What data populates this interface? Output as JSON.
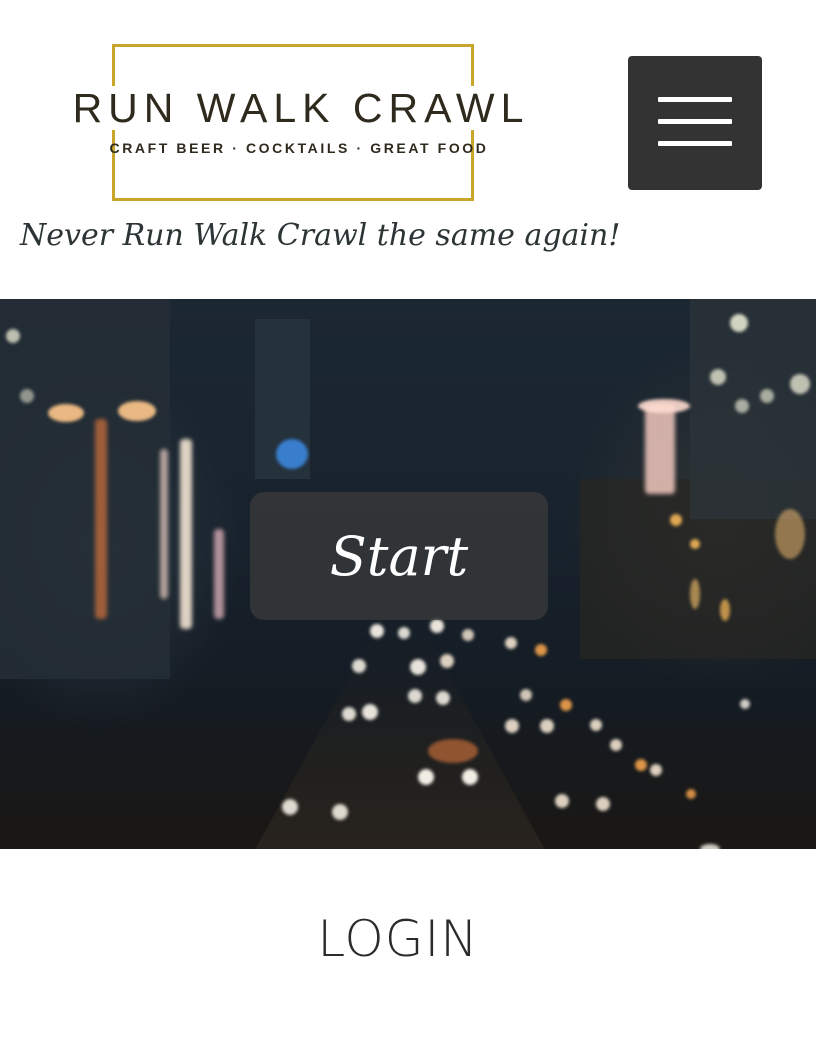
{
  "header": {
    "logo": {
      "title": "RUN WALK CRAWL",
      "tagline": "CRAFT BEER · COCKTAILS · GREAT FOOD",
      "border_color": "#c9a52c"
    },
    "menu_icon": "hamburger-menu-icon",
    "tagline": "Never Run Walk Crawl the same again!"
  },
  "hero": {
    "background": "blurred city night street with traffic lights",
    "start_label": "Start"
  },
  "login": {
    "label": "LOGIN"
  },
  "colors": {
    "menu_button_bg": "#333333",
    "text_dark": "#2b2b2b",
    "accent_gold": "#c9a52c"
  }
}
